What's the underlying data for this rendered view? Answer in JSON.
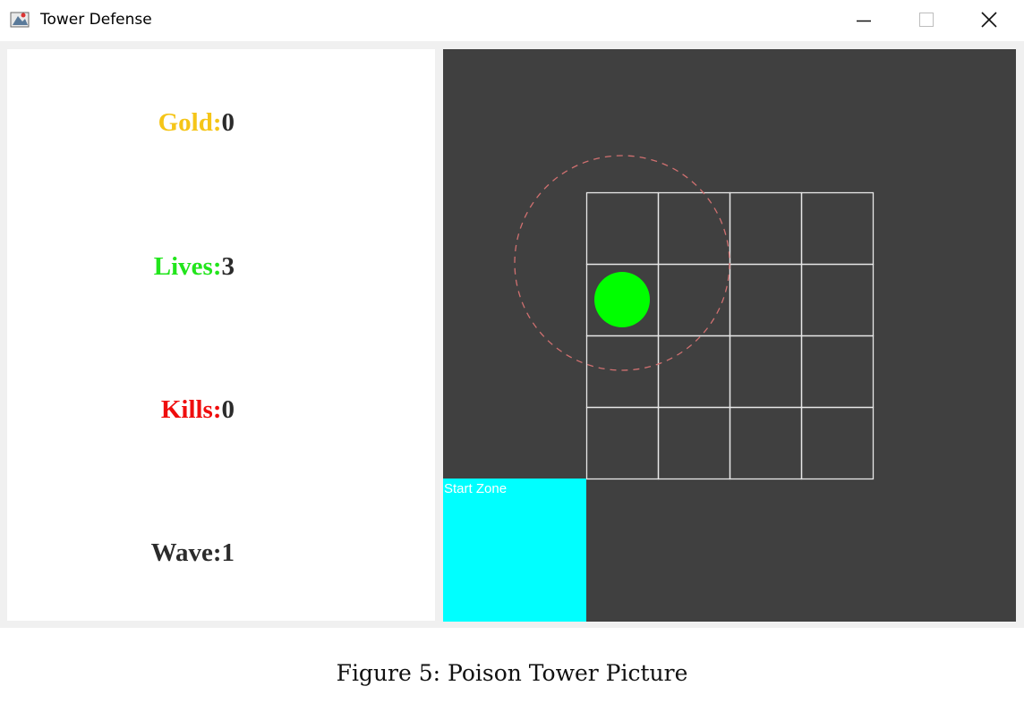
{
  "window": {
    "title": "Tower Defense",
    "icon": "tower-defense-app-icon",
    "controls": [
      "minimize-icon",
      "maximize-icon",
      "close-icon"
    ]
  },
  "stats": {
    "gold": {
      "label": "Gold:",
      "value": "0",
      "color": "#f5c518"
    },
    "lives": {
      "label": "Lives:",
      "value": "3",
      "color": "#22e51c"
    },
    "kills": {
      "label": "Kills:",
      "value": "0",
      "color": "#ef0d0d"
    },
    "wave": {
      "label": "Wave:",
      "value": "1",
      "color": "#2b2b2b"
    }
  },
  "game": {
    "background": "#404040",
    "grid": {
      "rows": 4,
      "cols": 4,
      "line_color": "#e8e8e8"
    },
    "tower": {
      "type": "poison",
      "row": 1,
      "col": 0,
      "color": "#00ff00",
      "range_color": "#d07070"
    },
    "start_zone": {
      "label": "Start Zone",
      "color": "#00ffff"
    }
  },
  "caption": "Figure 5: Poison Tower Picture"
}
